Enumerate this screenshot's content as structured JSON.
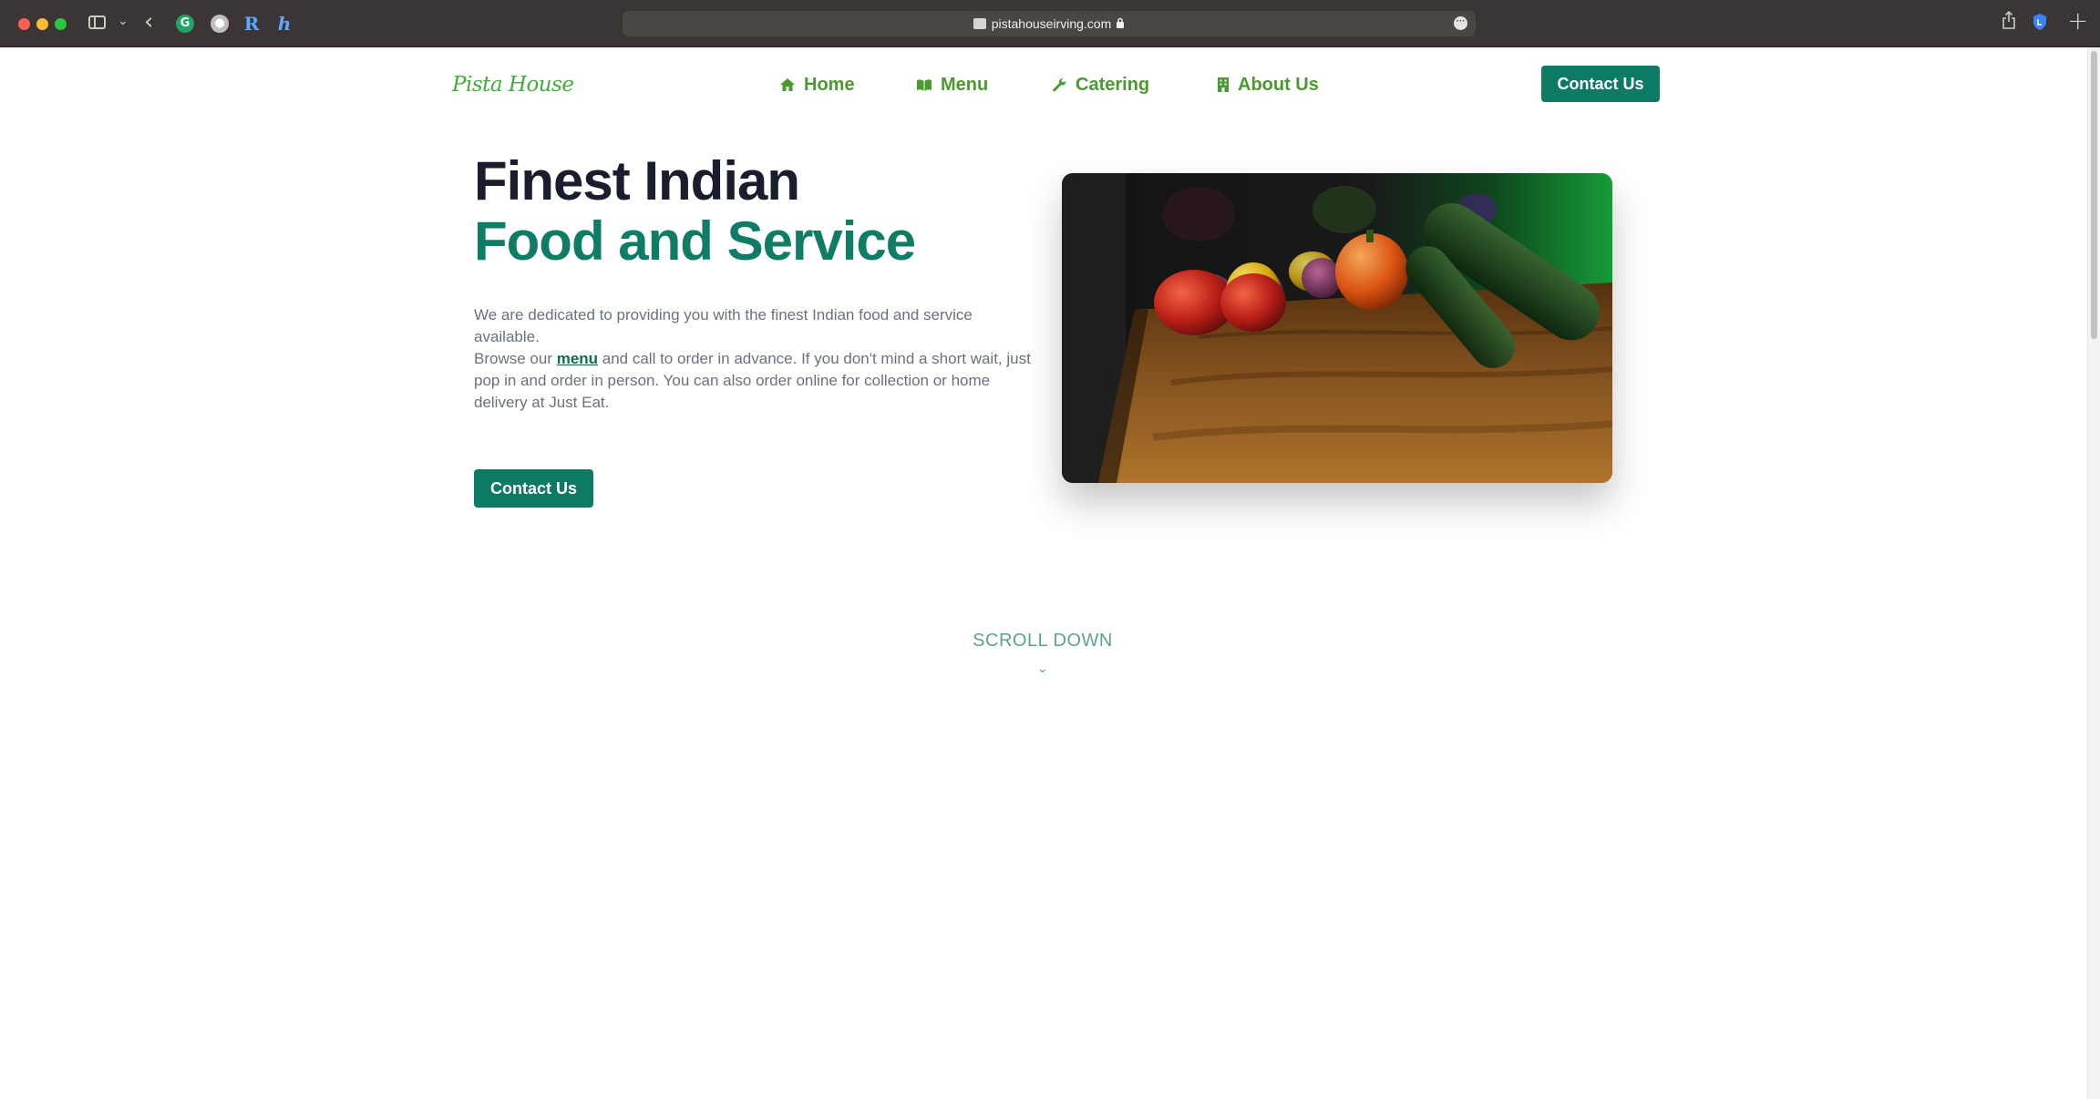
{
  "browser": {
    "url": "pistahouseirving.com",
    "extensions": [
      "grammarly-icon",
      "circle-extension-icon",
      "r-extension-icon",
      "h-extension-icon"
    ]
  },
  "site": {
    "logo": "Pista House",
    "nav": [
      {
        "label": "Home",
        "icon": "home-icon"
      },
      {
        "label": "Menu",
        "icon": "book-icon"
      },
      {
        "label": "Catering",
        "icon": "wrench-icon"
      },
      {
        "label": "About Us",
        "icon": "building-icon"
      }
    ],
    "header_cta": "Contact Us"
  },
  "hero": {
    "title_line1": "Finest Indian",
    "title_line2": "Food and Service",
    "paragraph1": "We are dedicated to providing you with the finest Indian food and service available.",
    "paragraph2_prefix": "Browse our ",
    "paragraph2_link": "menu",
    "paragraph2_suffix": " and call to order in advance. If you don't mind a short wait, just pop in and order in person. You can also order online for collection or home delivery at Just Eat.",
    "cta": "Contact Us",
    "image_subject": "vegetables-on-cutting-board"
  },
  "scroll_hint": "SCROLL DOWN",
  "colors": {
    "brand_green": "#0d7a64",
    "nav_green": "#4a9a31",
    "heading_dark": "#1a1d2b",
    "body_text": "#6a7080"
  }
}
